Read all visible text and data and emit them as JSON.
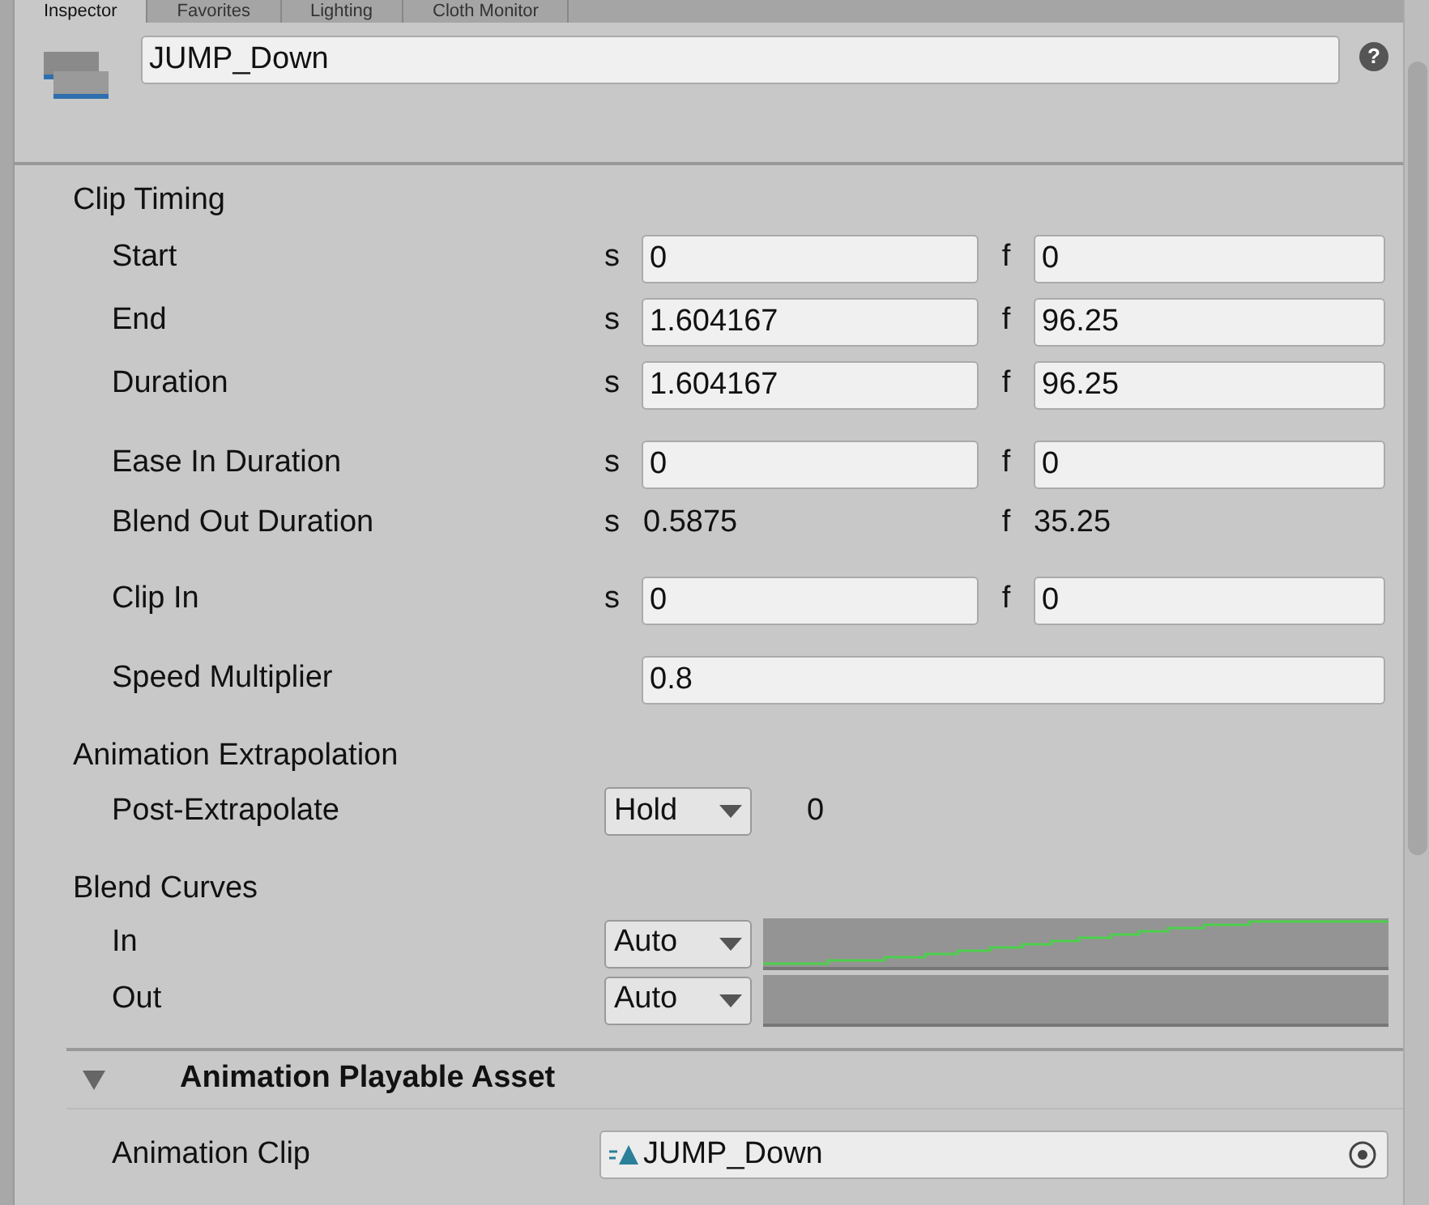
{
  "tabs": [
    {
      "label": "Inspector",
      "selected": true
    },
    {
      "label": "Favorites",
      "selected": false
    },
    {
      "label": "Lighting",
      "selected": false
    },
    {
      "label": "Cloth Monitor",
      "selected": false
    }
  ],
  "header": {
    "name_field": "JUMP_Down",
    "help": "?"
  },
  "clip_timing": {
    "title": "Clip Timing",
    "groups": [
      [
        {
          "label": "Start",
          "kind": "pair",
          "s": "s",
          "s_value": "0",
          "f": "f",
          "f_value": "0"
        },
        {
          "label": "End",
          "kind": "pair",
          "s": "s",
          "s_value": "1.604167",
          "f": "f",
          "f_value": "96.25"
        },
        {
          "label": "Duration",
          "kind": "pair",
          "s": "s",
          "s_value": "1.604167",
          "f": "f",
          "f_value": "96.25"
        }
      ],
      [
        {
          "label": "Ease In Duration",
          "kind": "pair",
          "s": "s",
          "s_value": "0",
          "f": "f",
          "f_value": "0"
        },
        {
          "label": "Blend Out Duration",
          "kind": "readonly",
          "s": "s",
          "s_value": "0.5875",
          "f": "f",
          "f_value": "35.25"
        }
      ],
      [
        {
          "label": "Clip In",
          "kind": "pair",
          "s": "s",
          "s_value": "0",
          "f": "f",
          "f_value": "0"
        }
      ],
      [
        {
          "label": "Speed Multiplier",
          "kind": "single",
          "value": "0.8"
        }
      ]
    ]
  },
  "extrapolation": {
    "title": "Animation Extrapolation",
    "label": "Post-Extrapolate",
    "dropdown": "Hold",
    "value": "0"
  },
  "blend_curves": {
    "title": "Blend Curves",
    "rows": [
      {
        "label": "In",
        "dropdown": "Auto",
        "kind": "rising"
      },
      {
        "label": "Out",
        "dropdown": "Auto",
        "kind": "empty"
      }
    ]
  },
  "asset": {
    "title": "Animation Playable Asset",
    "expanded": true,
    "label": "Animation Clip",
    "value": "JUMP_Down"
  }
}
